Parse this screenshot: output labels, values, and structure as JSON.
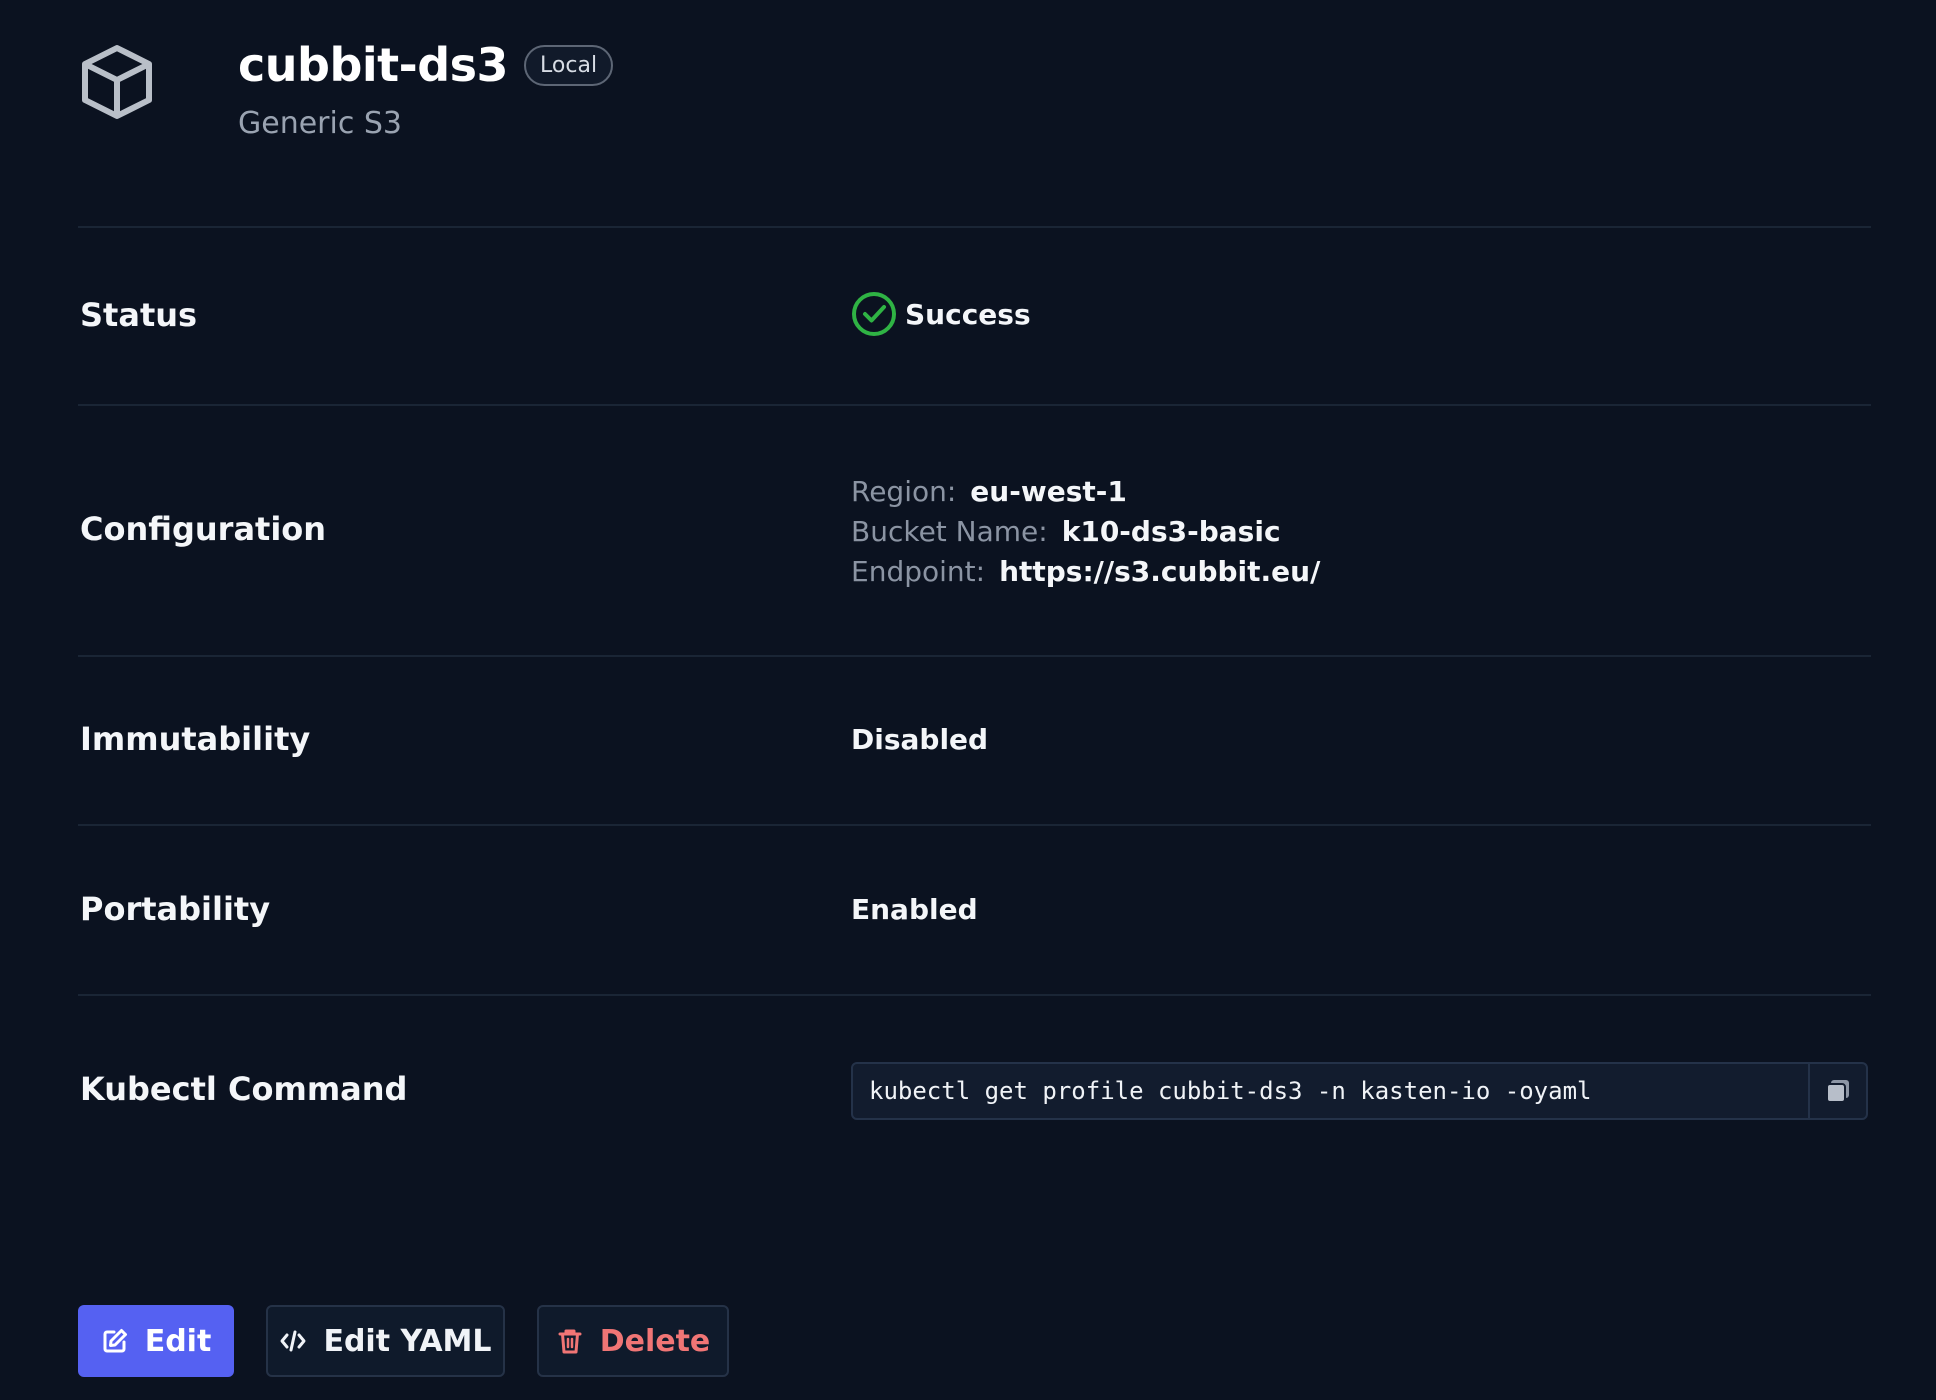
{
  "profile": {
    "name": "cubbit-ds3",
    "badge": "Local",
    "type": "Generic S3"
  },
  "rows": {
    "status": {
      "label": "Status",
      "value": "Success"
    },
    "configuration": {
      "label": "Configuration",
      "region_key": "Region:",
      "region_value": "eu-west-1",
      "bucket_key": "Bucket Name:",
      "bucket_value": "k10-ds3-basic",
      "endpoint_key": "Endpoint:",
      "endpoint_value": "https://s3.cubbit.eu/"
    },
    "immutability": {
      "label": "Immutability",
      "value": "Disabled"
    },
    "portability": {
      "label": "Portability",
      "value": "Enabled"
    },
    "kubectl": {
      "label": "Kubectl Command",
      "command": "kubectl get profile cubbit-ds3 -n kasten-io -oyaml"
    }
  },
  "actions": {
    "edit": "Edit",
    "edit_yaml": "Edit YAML",
    "delete": "Delete"
  },
  "icons": {
    "logo": "cube-icon",
    "status": "check-circle-icon",
    "copy": "copy-icon",
    "edit": "edit-icon",
    "code": "code-icon",
    "delete": "trash-icon"
  },
  "colors": {
    "background": "#0b1220",
    "success": "#2fb344",
    "primary": "#5561f2",
    "danger": "#f07575"
  }
}
